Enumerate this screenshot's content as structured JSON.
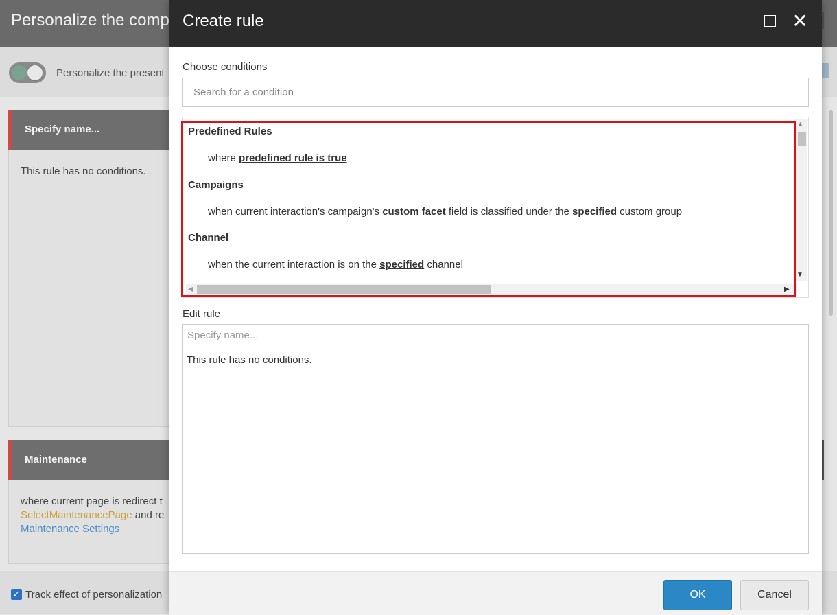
{
  "background": {
    "title": "Personalize the compo",
    "toggle_label": "Personalize the present",
    "panels": [
      {
        "header": "Specify name...",
        "text": "This rule has no conditions."
      },
      {
        "header": "Maintenance",
        "line1": "where current page is redirect t",
        "line2_link": "SelectMaintenancePage",
        "line2_rest": " and re",
        "line3_link": "Maintenance Settings"
      }
    ],
    "track_label": "Track effect of personalization"
  },
  "modal": {
    "title": "Create rule",
    "choose_label": "Choose conditions",
    "search_placeholder": "Search for a condition",
    "groups": [
      {
        "name": "Predefined Rules",
        "rule_pre": "where ",
        "rule_link1": "predefined rule is true",
        "rule_mid": "",
        "rule_link2": "",
        "rule_post": ""
      },
      {
        "name": "Campaigns",
        "rule_pre": "when current interaction's campaign's ",
        "rule_link1": "custom facet",
        "rule_mid": " field is classified under the ",
        "rule_link2": "specified",
        "rule_post": " custom group"
      },
      {
        "name": "Channel",
        "rule_pre": "when the current interaction is on the ",
        "rule_link1": "specified",
        "rule_mid": " channel",
        "rule_link2": "",
        "rule_post": ""
      }
    ],
    "edit_label": "Edit rule",
    "edit_placeholder": "Specify name...",
    "edit_text": "This rule has no conditions.",
    "ok_label": "OK",
    "cancel_label": "Cancel",
    "icons": {
      "maximize": "maximize-icon",
      "close": "close-icon"
    }
  }
}
